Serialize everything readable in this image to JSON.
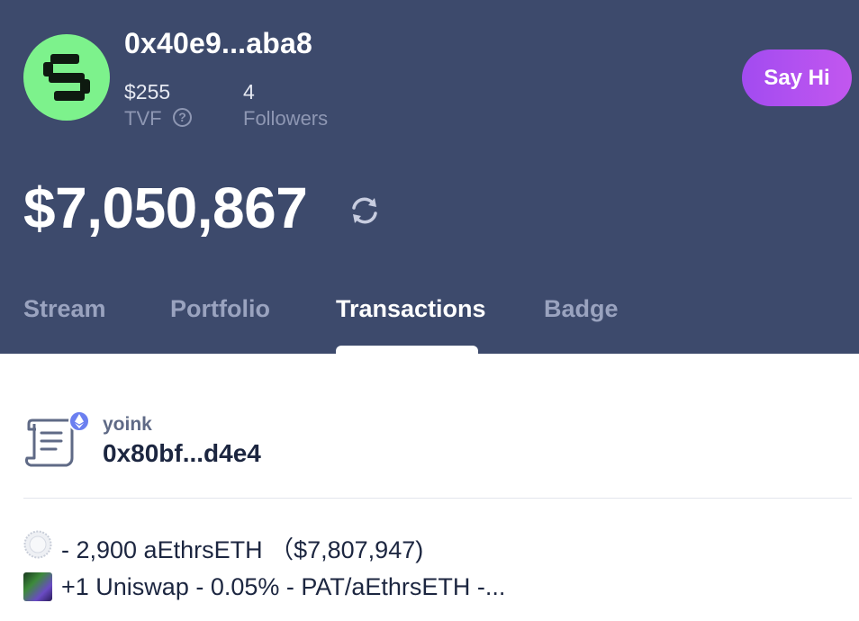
{
  "profile": {
    "address": "0x40e9...aba8",
    "tvf_value": "$255",
    "tvf_label": "TVF",
    "followers_value": "4",
    "followers_label": "Followers",
    "say_hi_label": "Say Hi",
    "total_value": "$7,050,867"
  },
  "tabs": [
    {
      "label": "Stream",
      "active": false
    },
    {
      "label": "Portfolio",
      "active": false
    },
    {
      "label": "Transactions",
      "active": true
    },
    {
      "label": "Badge",
      "active": false
    }
  ],
  "transaction": {
    "label": "yoink",
    "address": "0x80bf...d4e4",
    "chain_icon": "ethereum-icon",
    "changes": [
      {
        "icon": "token-icon",
        "text": "- 2,900 aEthrsETH （$7,807,947)"
      },
      {
        "icon": "nft-icon",
        "text": "+1 Uniswap - 0.05% - PAT/aEthrsETH -..."
      }
    ]
  },
  "colors": {
    "header_bg": "#3d4a6c",
    "avatar_bg": "#7df28c",
    "button_gradient_start": "#a24bf0",
    "button_gradient_end": "#c257ef",
    "active_tab": "#ffffff",
    "inactive_tab": "#9aa3bf"
  }
}
